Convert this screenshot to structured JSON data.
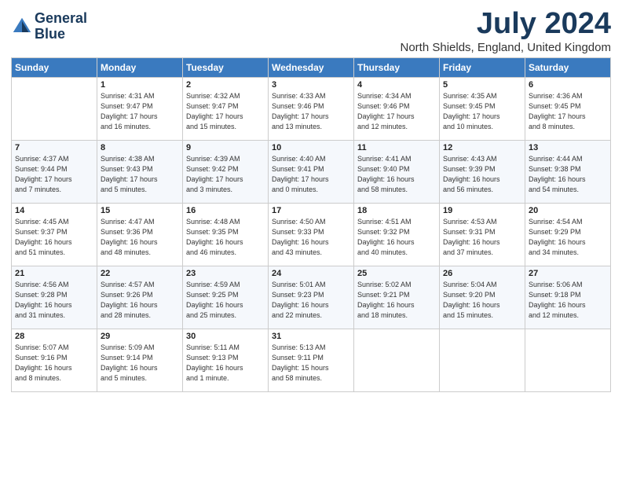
{
  "header": {
    "logo_line1": "General",
    "logo_line2": "Blue",
    "month_year": "July 2024",
    "location": "North Shields, England, United Kingdom"
  },
  "days_of_week": [
    "Sunday",
    "Monday",
    "Tuesday",
    "Wednesday",
    "Thursday",
    "Friday",
    "Saturday"
  ],
  "weeks": [
    [
      {
        "day": "",
        "content": ""
      },
      {
        "day": "1",
        "content": "Sunrise: 4:31 AM\nSunset: 9:47 PM\nDaylight: 17 hours\nand 16 minutes."
      },
      {
        "day": "2",
        "content": "Sunrise: 4:32 AM\nSunset: 9:47 PM\nDaylight: 17 hours\nand 15 minutes."
      },
      {
        "day": "3",
        "content": "Sunrise: 4:33 AM\nSunset: 9:46 PM\nDaylight: 17 hours\nand 13 minutes."
      },
      {
        "day": "4",
        "content": "Sunrise: 4:34 AM\nSunset: 9:46 PM\nDaylight: 17 hours\nand 12 minutes."
      },
      {
        "day": "5",
        "content": "Sunrise: 4:35 AM\nSunset: 9:45 PM\nDaylight: 17 hours\nand 10 minutes."
      },
      {
        "day": "6",
        "content": "Sunrise: 4:36 AM\nSunset: 9:45 PM\nDaylight: 17 hours\nand 8 minutes."
      }
    ],
    [
      {
        "day": "7",
        "content": "Sunrise: 4:37 AM\nSunset: 9:44 PM\nDaylight: 17 hours\nand 7 minutes."
      },
      {
        "day": "8",
        "content": "Sunrise: 4:38 AM\nSunset: 9:43 PM\nDaylight: 17 hours\nand 5 minutes."
      },
      {
        "day": "9",
        "content": "Sunrise: 4:39 AM\nSunset: 9:42 PM\nDaylight: 17 hours\nand 3 minutes."
      },
      {
        "day": "10",
        "content": "Sunrise: 4:40 AM\nSunset: 9:41 PM\nDaylight: 17 hours\nand 0 minutes."
      },
      {
        "day": "11",
        "content": "Sunrise: 4:41 AM\nSunset: 9:40 PM\nDaylight: 16 hours\nand 58 minutes."
      },
      {
        "day": "12",
        "content": "Sunrise: 4:43 AM\nSunset: 9:39 PM\nDaylight: 16 hours\nand 56 minutes."
      },
      {
        "day": "13",
        "content": "Sunrise: 4:44 AM\nSunset: 9:38 PM\nDaylight: 16 hours\nand 54 minutes."
      }
    ],
    [
      {
        "day": "14",
        "content": "Sunrise: 4:45 AM\nSunset: 9:37 PM\nDaylight: 16 hours\nand 51 minutes."
      },
      {
        "day": "15",
        "content": "Sunrise: 4:47 AM\nSunset: 9:36 PM\nDaylight: 16 hours\nand 48 minutes."
      },
      {
        "day": "16",
        "content": "Sunrise: 4:48 AM\nSunset: 9:35 PM\nDaylight: 16 hours\nand 46 minutes."
      },
      {
        "day": "17",
        "content": "Sunrise: 4:50 AM\nSunset: 9:33 PM\nDaylight: 16 hours\nand 43 minutes."
      },
      {
        "day": "18",
        "content": "Sunrise: 4:51 AM\nSunset: 9:32 PM\nDaylight: 16 hours\nand 40 minutes."
      },
      {
        "day": "19",
        "content": "Sunrise: 4:53 AM\nSunset: 9:31 PM\nDaylight: 16 hours\nand 37 minutes."
      },
      {
        "day": "20",
        "content": "Sunrise: 4:54 AM\nSunset: 9:29 PM\nDaylight: 16 hours\nand 34 minutes."
      }
    ],
    [
      {
        "day": "21",
        "content": "Sunrise: 4:56 AM\nSunset: 9:28 PM\nDaylight: 16 hours\nand 31 minutes."
      },
      {
        "day": "22",
        "content": "Sunrise: 4:57 AM\nSunset: 9:26 PM\nDaylight: 16 hours\nand 28 minutes."
      },
      {
        "day": "23",
        "content": "Sunrise: 4:59 AM\nSunset: 9:25 PM\nDaylight: 16 hours\nand 25 minutes."
      },
      {
        "day": "24",
        "content": "Sunrise: 5:01 AM\nSunset: 9:23 PM\nDaylight: 16 hours\nand 22 minutes."
      },
      {
        "day": "25",
        "content": "Sunrise: 5:02 AM\nSunset: 9:21 PM\nDaylight: 16 hours\nand 18 minutes."
      },
      {
        "day": "26",
        "content": "Sunrise: 5:04 AM\nSunset: 9:20 PM\nDaylight: 16 hours\nand 15 minutes."
      },
      {
        "day": "27",
        "content": "Sunrise: 5:06 AM\nSunset: 9:18 PM\nDaylight: 16 hours\nand 12 minutes."
      }
    ],
    [
      {
        "day": "28",
        "content": "Sunrise: 5:07 AM\nSunset: 9:16 PM\nDaylight: 16 hours\nand 8 minutes."
      },
      {
        "day": "29",
        "content": "Sunrise: 5:09 AM\nSunset: 9:14 PM\nDaylight: 16 hours\nand 5 minutes."
      },
      {
        "day": "30",
        "content": "Sunrise: 5:11 AM\nSunset: 9:13 PM\nDaylight: 16 hours\nand 1 minute."
      },
      {
        "day": "31",
        "content": "Sunrise: 5:13 AM\nSunset: 9:11 PM\nDaylight: 15 hours\nand 58 minutes."
      },
      {
        "day": "",
        "content": ""
      },
      {
        "day": "",
        "content": ""
      },
      {
        "day": "",
        "content": ""
      }
    ]
  ]
}
